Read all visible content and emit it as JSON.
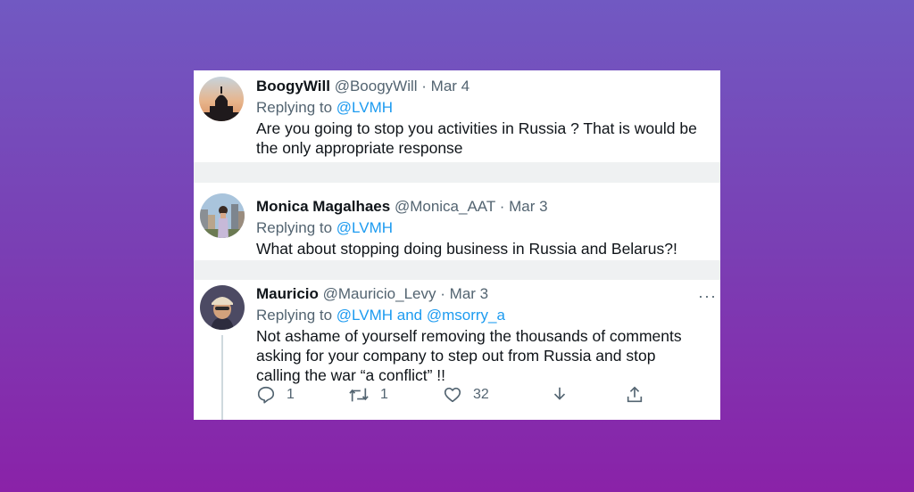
{
  "tweets": [
    {
      "name": "BoogyWill",
      "handle": "@BoogyWill",
      "sep": "·",
      "date": "Mar 4",
      "replying_prefix": "Replying to",
      "replying_to": "@LVMH",
      "text": "Are you going to stop you activities in Russia ? That is would be the only appropriate response"
    },
    {
      "name": "Monica Magalhaes",
      "handle": "@Monica_AAT",
      "sep": "·",
      "date": "Mar 3",
      "replying_prefix": "Replying to",
      "replying_to": "@LVMH",
      "text": "What about stopping doing business in Russia and Belarus?!"
    },
    {
      "name": "Mauricio",
      "handle": "@Mauricio_Levy",
      "sep": "·",
      "date": "Mar 3",
      "replying_prefix": "Replying to",
      "replying_to": "@LVMH and @msorry_a",
      "text": "Not ashame of yourself removing the thousands of comments asking for your company to step out from Russia and stop calling the war “a conflict” !!",
      "more": "···",
      "actions": {
        "reply_count": "1",
        "retweet_count": "1",
        "like_count": "32"
      }
    }
  ],
  "colors": {
    "link": "#1d9bf0",
    "muted": "#536471",
    "text": "#0f1419"
  }
}
